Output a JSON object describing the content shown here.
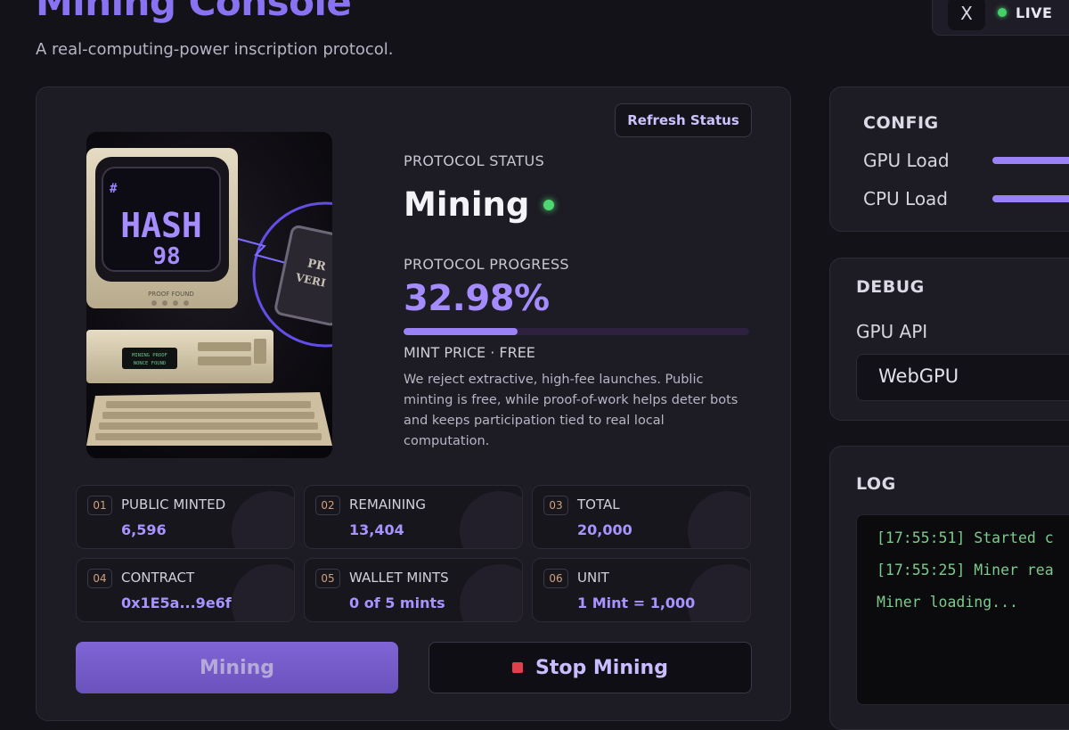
{
  "header": {
    "title": "Mining Console",
    "subtitle": "A real-computing-power inscription protocol.",
    "x_label": "X",
    "live_label": "LIVE"
  },
  "main": {
    "refresh_label": "Refresh Status",
    "art": {
      "screen_tag": "#",
      "screen_line1": "HASH",
      "screen_line2": "98",
      "monitor_label": "PROOF FOUND",
      "lcd_line1": "MINING PROOF",
      "lcd_line2": "NONCE FOUND",
      "chip_line1": "PR",
      "chip_line2": "VERI"
    },
    "protocol_status_label": "PROTOCOL STATUS",
    "status_value": "Mining",
    "protocol_progress_label": "PROTOCOL PROGRESS",
    "progress_text": "32.98%",
    "progress_fraction": 0.3298,
    "mint_price": "MINT PRICE · FREE",
    "description": "We reject extractive, high-fee launches. Public minting is free, while proof-of-work helps deter bots and keeps participation tied to real local computation.",
    "stats": [
      {
        "num": "01",
        "label": "PUBLIC MINTED",
        "value": "6,596"
      },
      {
        "num": "02",
        "label": "REMAINING",
        "value": "13,404"
      },
      {
        "num": "03",
        "label": "TOTAL",
        "value": "20,000"
      },
      {
        "num": "04",
        "label": "CONTRACT",
        "value": "0x1E5a...9e6f"
      },
      {
        "num": "05",
        "label": "WALLET MINTS",
        "value": "0 of 5 mints"
      },
      {
        "num": "06",
        "label": "UNIT",
        "value": "1 Mint = 1,000"
      }
    ],
    "mining_button": "Mining",
    "stop_button": "Stop Mining"
  },
  "config": {
    "title": "CONFIG",
    "gpu_load_label": "GPU Load",
    "cpu_load_label": "CPU Load"
  },
  "debug": {
    "title": "DEBUG",
    "gpu_api_label": "GPU API",
    "gpu_api_value": "WebGPU"
  },
  "log": {
    "title": "LOG",
    "lines": [
      "[17:55:51] Started c",
      "[17:55:25] Miner rea",
      "Miner loading..."
    ]
  },
  "colors": {
    "accent": "#9a82f6",
    "live_green": "#46d06a",
    "stop_red": "#e0404e",
    "log_green": "#7ec98d"
  }
}
